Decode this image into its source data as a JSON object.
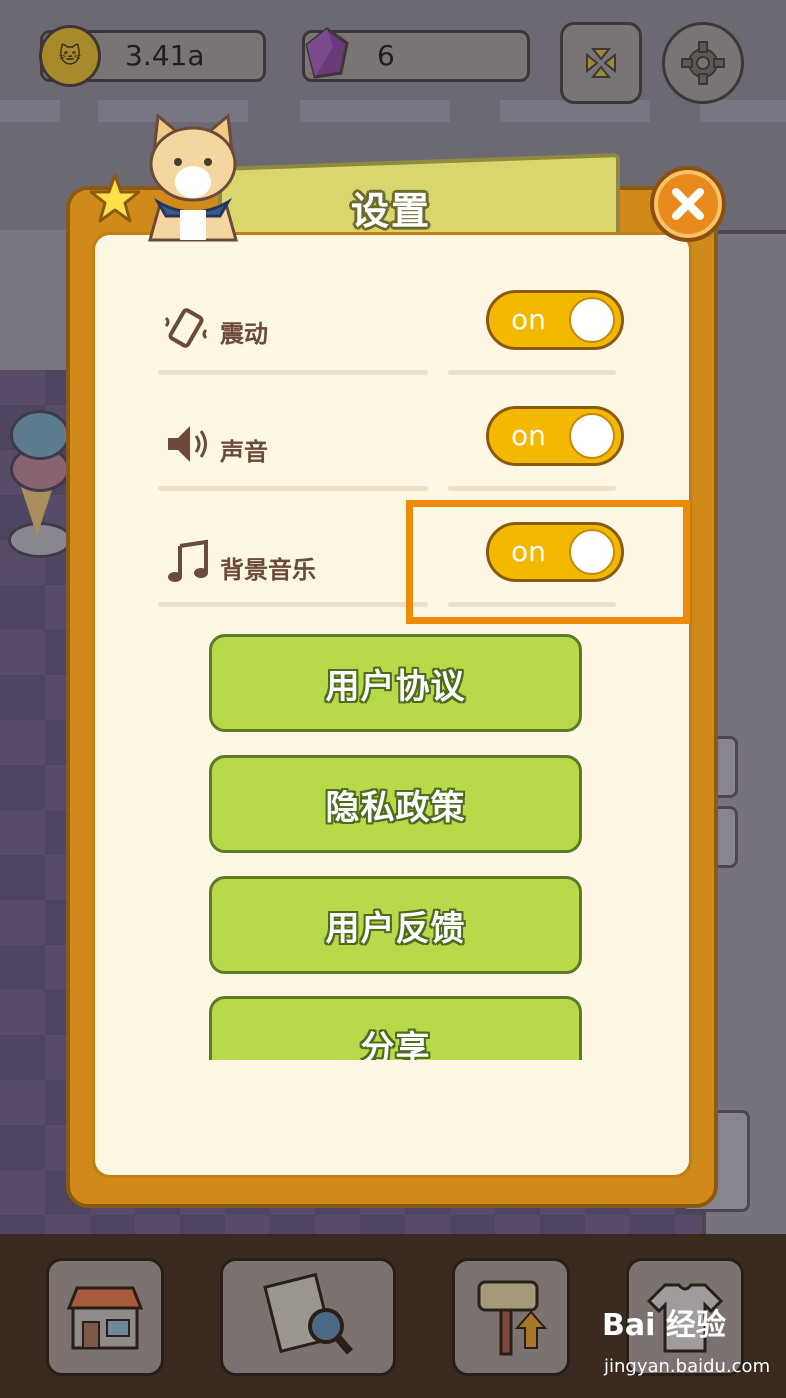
{
  "hud": {
    "coin_value": "3.41a",
    "gem_value": "6"
  },
  "dialog": {
    "title": "设置",
    "settings": [
      {
        "label": "震动",
        "toggle": "on",
        "icon": "vibrate-icon"
      },
      {
        "label": "声音",
        "toggle": "on",
        "icon": "speaker-icon"
      },
      {
        "label": "背景音乐",
        "toggle": "on",
        "icon": "music-note-icon"
      }
    ],
    "buttons": [
      {
        "label": "用户协议"
      },
      {
        "label": "隐私政策"
      },
      {
        "label": "用户反馈"
      },
      {
        "label": "分享"
      }
    ]
  },
  "watermark": {
    "brand": "Bai 经验",
    "url": "jingyan.baidu.com"
  },
  "colors": {
    "toggle_on": "#f5b800",
    "green_button": "#b8d94a",
    "dialog_frame": "#cf8a1a",
    "highlight": "#ee8a06"
  }
}
